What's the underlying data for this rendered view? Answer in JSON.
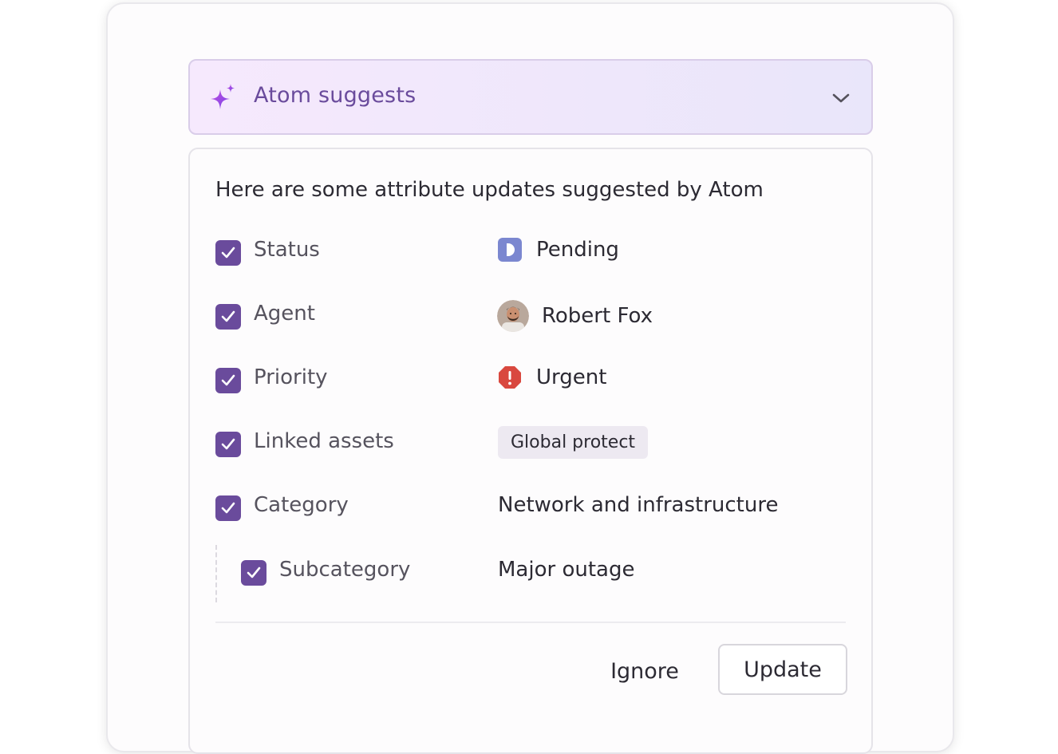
{
  "header": {
    "title": "Atom suggests",
    "icon": "sparkle-icon",
    "toggle_icon": "chevron-down-icon"
  },
  "panel": {
    "intro": "Here are some attribute updates suggested by Atom",
    "rows": [
      {
        "label": "Status",
        "checked": true,
        "value": "Pending",
        "value_icon": "pending-status-icon"
      },
      {
        "label": "Agent",
        "checked": true,
        "value": "Robert Fox",
        "value_icon": "avatar"
      },
      {
        "label": "Priority",
        "checked": true,
        "value": "Urgent",
        "value_icon": "urgent-alert-icon"
      },
      {
        "label": "Linked assets",
        "checked": true,
        "value": "Global protect",
        "value_style": "tag"
      },
      {
        "label": "Category",
        "checked": true,
        "value": "Network and infrastructure"
      },
      {
        "label": "Subcategory",
        "checked": true,
        "value": "Major outage",
        "nested": true
      }
    ]
  },
  "actions": {
    "ignore_label": "Ignore",
    "update_label": "Update"
  },
  "colors": {
    "accent": "#6a4b9c",
    "pending": "#7b87d0",
    "urgent": "#d9483f",
    "header_gradient_start": "#f6e9fd",
    "header_gradient_end": "#e9e6fa"
  }
}
